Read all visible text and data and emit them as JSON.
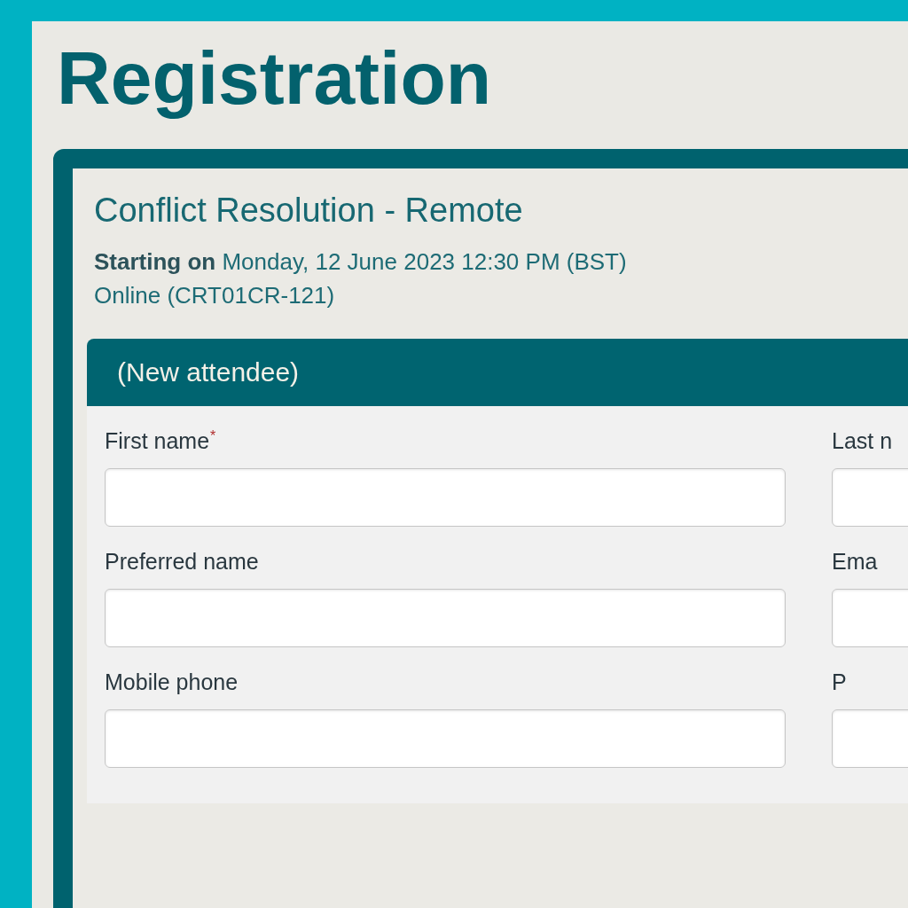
{
  "page": {
    "title": "Registration"
  },
  "course": {
    "title": "Conflict Resolution - Remote",
    "schedule": "**Starting on** Monday, 12 June 2023 12:30 PM (BST)",
    "location": "Online (CRT01CR-121)"
  },
  "attendee": {
    "heading": "(New attendee)",
    "columns": [
      {
        "fields": [
          {
            "label": "First name$^{*}$"
          },
          {
            "label": "Preferred name"
          },
          {
            "label": "Mobile phone"
          }
        ]
      },
      {
        "fields": [
          {
            "label": "Last n"
          },
          {
            "label": "Ema"
          },
          {
            "label": "P"
          }
        ]
      }
    ]
  }
}
